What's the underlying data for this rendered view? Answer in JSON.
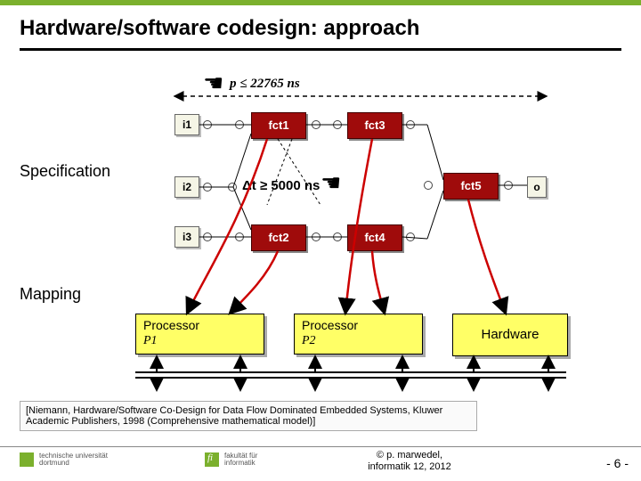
{
  "title": "Hardware/software codesign: approach",
  "labels": {
    "specification": "Specification",
    "mapping": "Mapping"
  },
  "inputs": {
    "i1": "i1",
    "i2": "i2",
    "i3": "i3"
  },
  "blocks": {
    "f1": "fct1",
    "f2": "fct2",
    "f3": "fct3",
    "f4": "fct4",
    "f5": "fct5"
  },
  "output": "o",
  "constraints": {
    "period": "p ≤ 22765 ns",
    "delta": "Δt ≥ 5000 ns"
  },
  "procs": {
    "a_title": "Processor",
    "a_name": "P1",
    "b_title": "Processor",
    "b_name": "P2",
    "hw": "Hardware"
  },
  "ref": "[Niemann, Hardware/Software Co-Design for Data Flow Dominated Embedded Systems, Kluwer Academic Publishers, 1998 (Comprehensive mathematical model)]",
  "footer": {
    "tu1": "technische universität",
    "tu2": "dortmund",
    "fi1": "fakultät für",
    "fi2": "informatik",
    "copy1": "©  p. marwedel,",
    "copy2": "informatik 12,  2012",
    "page": "-  6 -"
  }
}
